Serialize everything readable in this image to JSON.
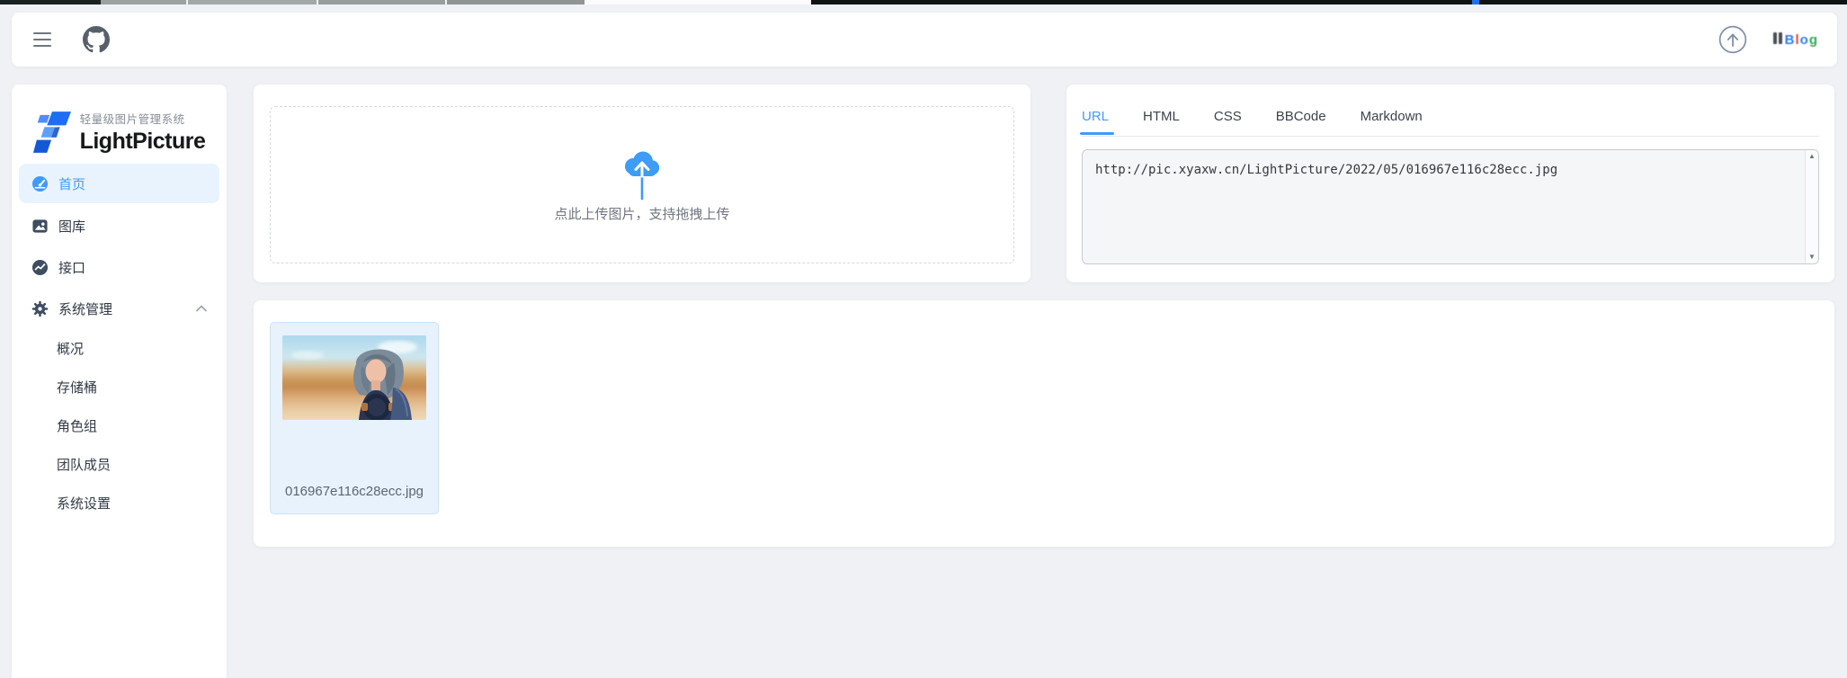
{
  "header": {
    "blog_logo_text": "Blog"
  },
  "sidebar": {
    "logo_subtitle": "轻量级图片管理系统",
    "logo_title": "LightPicture",
    "menu": [
      {
        "label": "首页",
        "icon": "dashboard-icon",
        "active": true
      },
      {
        "label": "图库",
        "icon": "picture-icon",
        "active": false
      },
      {
        "label": "接口",
        "icon": "api-icon",
        "active": false
      },
      {
        "label": "系统管理",
        "icon": "gear-icon",
        "active": false,
        "expanded": true
      }
    ],
    "submenu": [
      {
        "label": "概况"
      },
      {
        "label": "存储桶"
      },
      {
        "label": "角色组"
      },
      {
        "label": "团队成员"
      },
      {
        "label": "系统设置"
      }
    ]
  },
  "upload_panel": {
    "hint": "点此上传图片，支持拖拽上传"
  },
  "share_panel": {
    "tabs": [
      {
        "label": "URL",
        "active": true
      },
      {
        "label": "HTML",
        "active": false
      },
      {
        "label": "CSS",
        "active": false
      },
      {
        "label": "BBCode",
        "active": false
      },
      {
        "label": "Markdown",
        "active": false
      }
    ],
    "textarea_value": "http://pic.xyaxw.cn/LightPicture/2022/05/016967e116c28ecc.jpg"
  },
  "gallery_panel": {
    "items": [
      {
        "filename": "016967e116c28ecc.jpg"
      }
    ]
  },
  "icons": {
    "hamburger": "menu-icon (three horizontal bars)",
    "github": "github-icon (octocat mark)",
    "scroll_top": "arrow-up-circle-icon",
    "home": "dashboard-icon (blue gauge)",
    "gallery": "picture-icon",
    "api": "api-icon (circle with trend line)",
    "system": "gear-icon",
    "collapse": "chevron-up-icon",
    "upload": "cloud-upload-icon"
  },
  "colors": {
    "accent": "#3f9bfa",
    "active_item_bg": "#e8f3fe",
    "card_blue_bg": "#e7f2fd",
    "card_blue_border": "#cbe3f8",
    "page_bg": "#eff1f4",
    "icon_dark": "#3e4d61"
  }
}
